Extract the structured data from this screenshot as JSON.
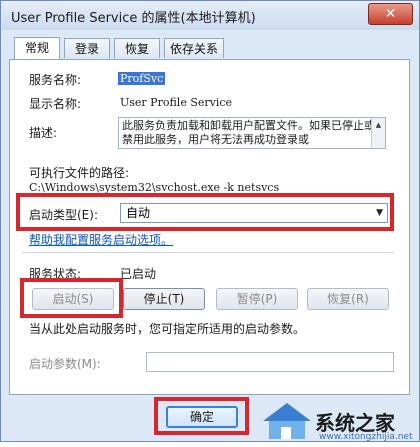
{
  "window": {
    "title": "User Profile Service 的属性(本地计算机)",
    "close": "✕"
  },
  "tabs": [
    {
      "label": "常规"
    },
    {
      "label": "登录"
    },
    {
      "label": "恢复"
    },
    {
      "label": "依存关系"
    }
  ],
  "general": {
    "service_name_label": "服务名称:",
    "service_name": "ProfSvc",
    "display_name_label": "显示名称:",
    "display_name": "User Profile Service",
    "description_label": "描述:",
    "description": "此服务负责加载和卸载用户配置文件。如果已停止或禁用此服务，用户将无法再成功登录或",
    "exe_path_label": "可执行文件的路径:",
    "exe_path": "C:\\Windows\\system32\\svchost.exe -k netsvcs",
    "startup_type_label": "启动类型(E):",
    "startup_type": "自动",
    "help_link": "帮助我配置服务启动选项。",
    "status_label": "服务状态:",
    "status_value": "已启动",
    "start_btn": "启动(S)",
    "stop_btn": "停止(T)",
    "pause_btn": "暂停(P)",
    "resume_btn": "恢复(R)",
    "hint": "当从此处启动服务时，您可指定所适用的启动参数。",
    "params_label": "启动参数(M):",
    "params_value": ""
  },
  "footer": {
    "ok_btn": "确定"
  },
  "watermark": {
    "text": "系统之家",
    "sub": "www.xitongzhijia.net"
  },
  "colors": {
    "highlight": "#d6262e",
    "accent": "#3b7fd6"
  }
}
